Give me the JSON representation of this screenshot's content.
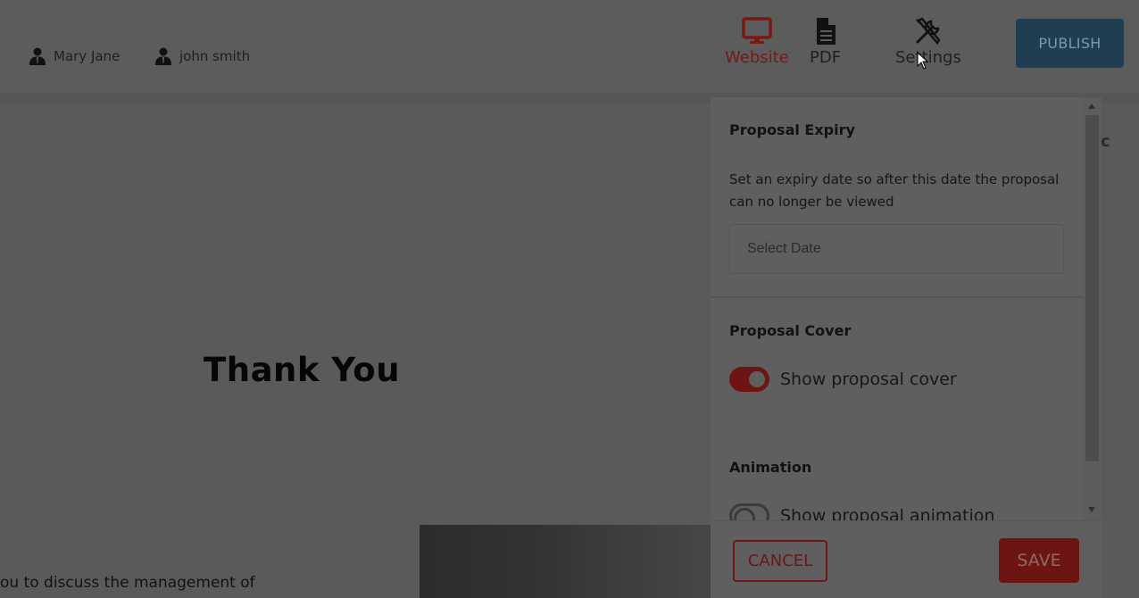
{
  "header": {
    "users": [
      {
        "name": "Mary Jane",
        "icon": "user-icon"
      },
      {
        "name": "john smith",
        "icon": "user-icon"
      }
    ],
    "nav": {
      "website_label": "Website",
      "pdf_label": "PDF",
      "settings_label": "Settings"
    },
    "publish_label": "PUBLISH"
  },
  "document": {
    "title": "Thank You",
    "snippet": "ou to discuss the management of",
    "mark": "c"
  },
  "settings_panel": {
    "expiry": {
      "title": "Proposal Expiry",
      "description": "Set an expiry date so after this date the proposal can no longer be viewed",
      "date_placeholder": "Select Date",
      "date_value": ""
    },
    "cover": {
      "title": "Proposal Cover",
      "toggle_label": "Show proposal cover",
      "enabled": true
    },
    "animation": {
      "title": "Animation",
      "toggle_label": "Show proposal animation",
      "enabled": false
    },
    "footer": {
      "cancel_label": "CANCEL",
      "save_label": "SAVE"
    }
  },
  "colors": {
    "accent_red": "#d32a22",
    "publish_blue": "#2a7bb0",
    "overlay_dim": "rgba(0,0,0,0.55)"
  }
}
